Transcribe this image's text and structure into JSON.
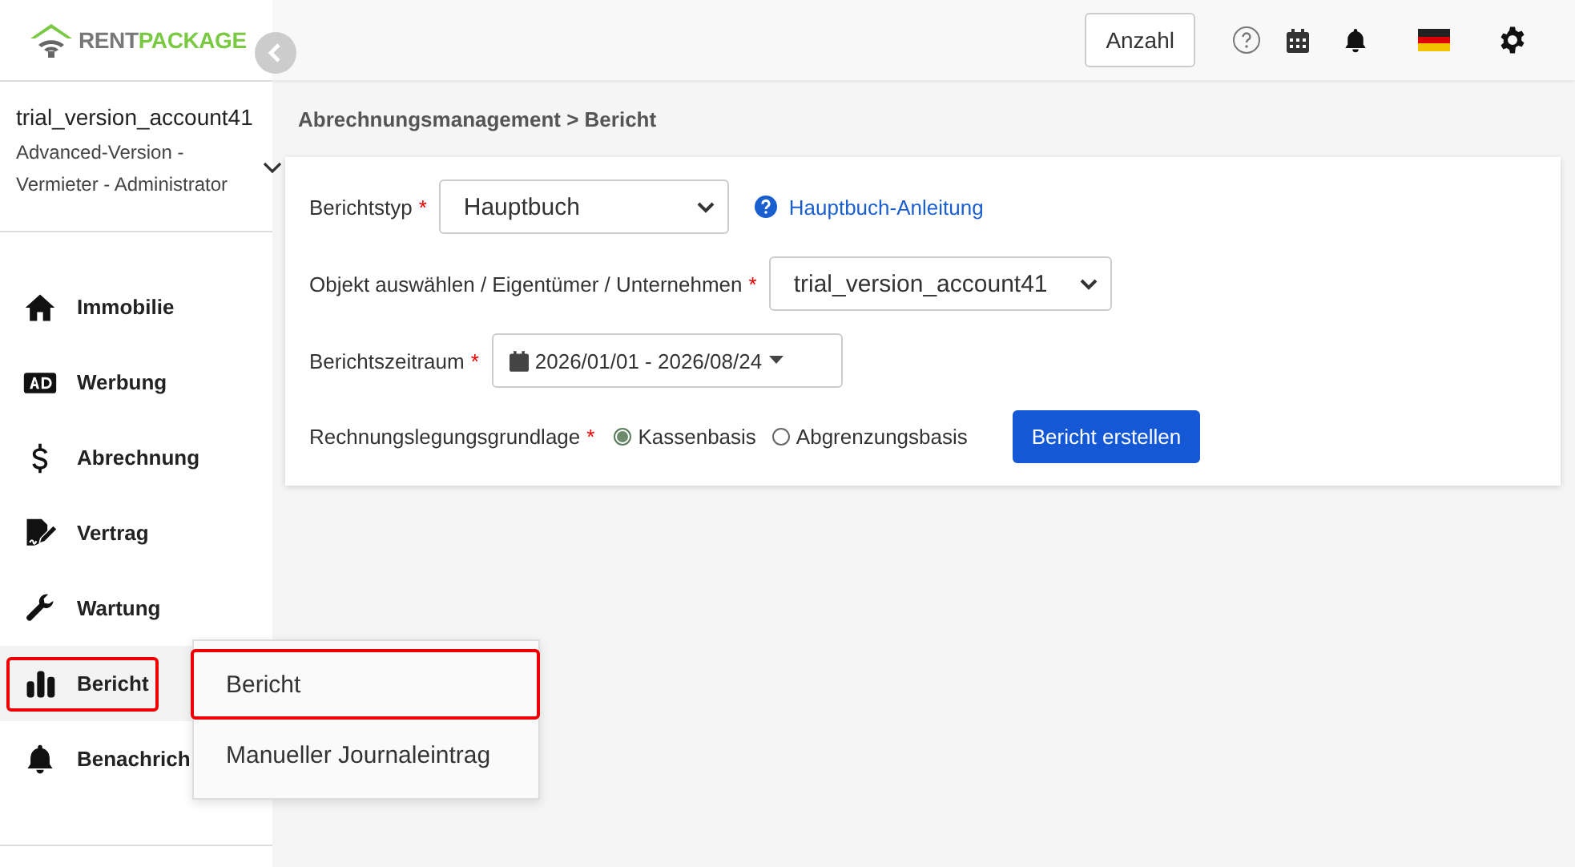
{
  "logo": {
    "word_a": "RENT",
    "word_b": "PACKAGE"
  },
  "account": {
    "name": "trial_version_account41",
    "role": "Advanced-Version - Vermieter - Administrator"
  },
  "sidebar": {
    "items": [
      {
        "label": "Immobilie",
        "selected": false,
        "highlighted": false
      },
      {
        "label": "Werbung",
        "selected": false,
        "highlighted": false
      },
      {
        "label": "Abrechnung",
        "selected": false,
        "highlighted": false
      },
      {
        "label": "Vertrag",
        "selected": false,
        "highlighted": false
      },
      {
        "label": "Wartung",
        "selected": false,
        "highlighted": false
      },
      {
        "label": "Bericht",
        "selected": true,
        "highlighted": true
      },
      {
        "label": "Benachrich",
        "selected": false,
        "highlighted": false
      }
    ]
  },
  "submenu": {
    "items": [
      {
        "label": "Bericht",
        "highlighted": true
      },
      {
        "label": "Manueller Journaleintrag",
        "highlighted": false
      }
    ]
  },
  "topbar": {
    "count_button": "Anzahl"
  },
  "breadcrumb": "Abrechnungsmanagement > Bericht",
  "form": {
    "report_type": {
      "label": "Berichtstyp",
      "required_mark": "*",
      "value": "Hauptbuch",
      "help_link": "Hauptbuch-Anleitung"
    },
    "object": {
      "label": "Objekt auswählen / Eigentümer / Unternehmen",
      "required_mark": "*",
      "value": "trial_version_account41"
    },
    "period": {
      "label": "Berichtszeitraum",
      "required_mark": "*",
      "value": "2026/01/01 - 2026/08/24"
    },
    "basis": {
      "label": "Rechnungslegungsgrundlage",
      "required_mark": "*",
      "options": [
        {
          "label": "Kassenbasis",
          "selected": true
        },
        {
          "label": "Abgrenzungsbasis",
          "selected": false
        }
      ]
    },
    "submit": "Bericht erstellen"
  }
}
